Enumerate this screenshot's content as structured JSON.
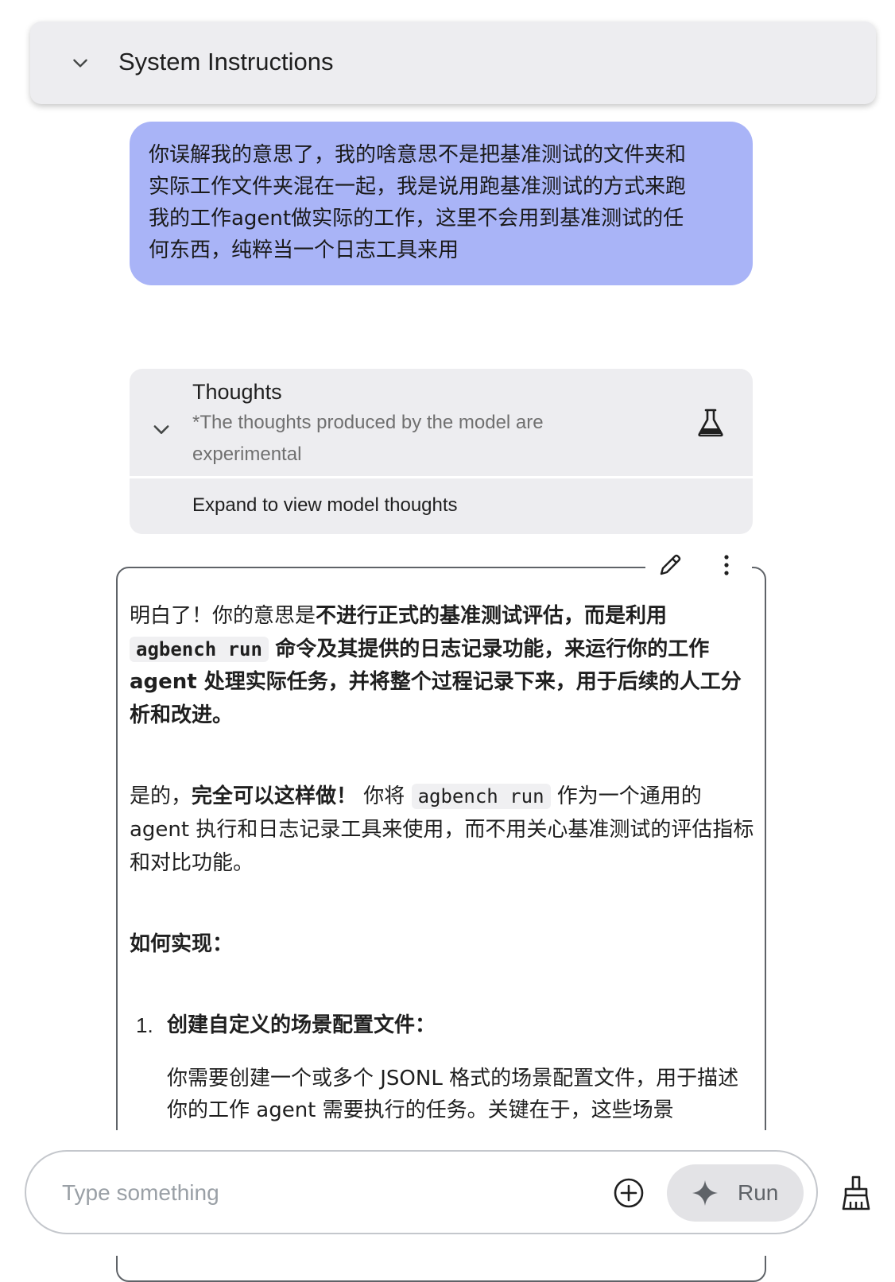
{
  "system_instructions": {
    "title": "System Instructions"
  },
  "user_message": {
    "lines": [
      "你误解我的意思了，我的啥意思不是把基准测试的文件夹和",
      "实际工作文件夹混在一起，我是说用跑基准测试的方式来跑",
      "我的工作agent做实际的工作，这里不会用到基准测试的任",
      "何东西，纯粹当一个日志工具来用"
    ]
  },
  "thoughts": {
    "title": "Thoughts",
    "subtitle": "*The thoughts produced by the model are experimental",
    "expand_label": "Expand to view model thoughts"
  },
  "response": {
    "p1": {
      "a": "明白了！你的意思是",
      "b": "不进行正式的基准测试评估，而是利用",
      "code": "agbench run",
      "c": "命令及其提供的日志记录功能，来运行你的工作 agent 处理实际任务，并将整个过程记录下来，用于后续的人工分析和改进。"
    },
    "p2": {
      "a": "是的，",
      "b": "完全可以这样做！",
      "c": "你将",
      "code": "agbench run",
      "d": "作为一个通用的 agent 执行和日志记录工具来使用，而不用关心基准测试的评估指标和对比功能。"
    },
    "heading": "如何实现：",
    "list": [
      {
        "num": "1.",
        "title": "创建自定义的场景配置文件：",
        "body": "你需要创建一个或多个 JSONL 格式的场景配置文件，用于描述你的工作 agent 需要执行的任务。关键在于，这些场景"
      }
    ]
  },
  "composer": {
    "placeholder": "Type something",
    "run_label": "Run"
  },
  "icons": [
    "chevron-down-icon",
    "flask-icon",
    "edit-icon",
    "more-vert-icon",
    "add-circle-icon",
    "sparkle-icon",
    "clear-broom-icon"
  ]
}
